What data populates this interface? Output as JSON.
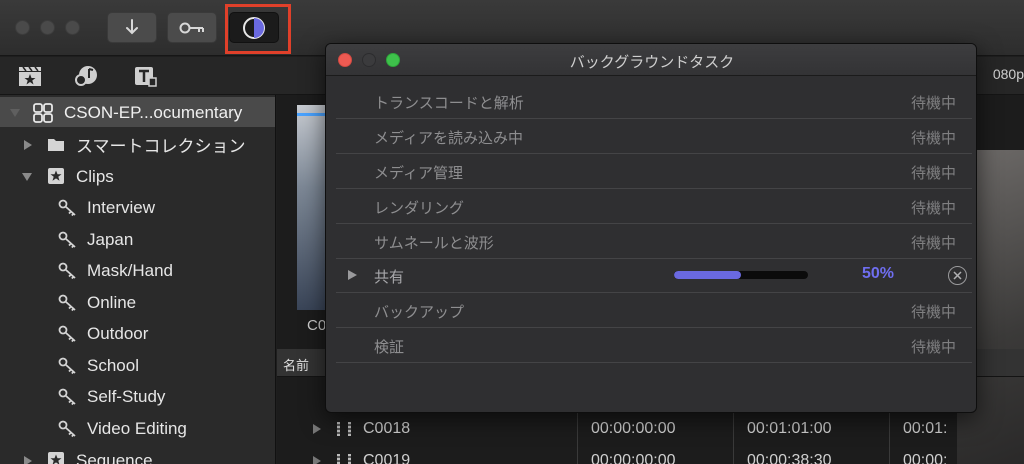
{
  "toolbar": {
    "buttons": [
      {
        "icon": "download-arrow-icon"
      },
      {
        "icon": "key-icon"
      },
      {
        "icon": "background-tasks-icon",
        "selected": true
      }
    ],
    "accent_color": "#6a69e0",
    "highlight_color": "#e0402a",
    "resolution_label": "080p"
  },
  "toolbar2": {
    "icons": [
      "clapperboard-star-icon",
      "music-photo-icon",
      "titles-icon"
    ]
  },
  "sidebar": {
    "library": "CSON-EP...ocumentary",
    "items": [
      {
        "label": "スマートコレクション",
        "icon": "folder-icon",
        "level": 1,
        "expanded": false
      },
      {
        "label": "Clips",
        "icon": "star-event-icon",
        "level": 1,
        "expanded": true
      },
      {
        "label": "Interview",
        "icon": "keyword-icon",
        "level": 2
      },
      {
        "label": "Japan",
        "icon": "keyword-icon",
        "level": 2
      },
      {
        "label": "Mask/Hand",
        "icon": "keyword-icon",
        "level": 2
      },
      {
        "label": "Online",
        "icon": "keyword-icon",
        "level": 2
      },
      {
        "label": "Outdoor",
        "icon": "keyword-icon",
        "level": 2
      },
      {
        "label": "School",
        "icon": "keyword-icon",
        "level": 2
      },
      {
        "label": "Self-Study",
        "icon": "keyword-icon",
        "level": 2
      },
      {
        "label": "Video Editing",
        "icon": "keyword-icon",
        "level": 2
      },
      {
        "label": "Sequence",
        "icon": "star-event-icon",
        "level": 1,
        "expanded": false
      }
    ]
  },
  "browser": {
    "thumb_label": "C0",
    "header": {
      "name": "名前"
    },
    "rows": [
      {
        "name": "C0018",
        "start": "00:00:00:00",
        "end": "00:01:01:00",
        "dur": "00:01:"
      },
      {
        "name": "C0019",
        "start": "00:00:00:00",
        "end": "00:00:38:30",
        "dur": "00:00:"
      }
    ]
  },
  "dialog": {
    "title": "バックグラウンドタスク",
    "tasks": [
      {
        "name": "トランスコードと解析",
        "status": "待機中"
      },
      {
        "name": "メディアを読み込み中",
        "status": "待機中"
      },
      {
        "name": "メディア管理",
        "status": "待機中"
      },
      {
        "name": "レンダリング",
        "status": "待機中"
      },
      {
        "name": "サムネールと波形",
        "status": "待機中"
      },
      {
        "name": "共有",
        "progress": 0.5,
        "percent": "50%"
      },
      {
        "name": "バックアップ",
        "status": "待機中"
      },
      {
        "name": "検証",
        "status": "待機中"
      }
    ]
  }
}
